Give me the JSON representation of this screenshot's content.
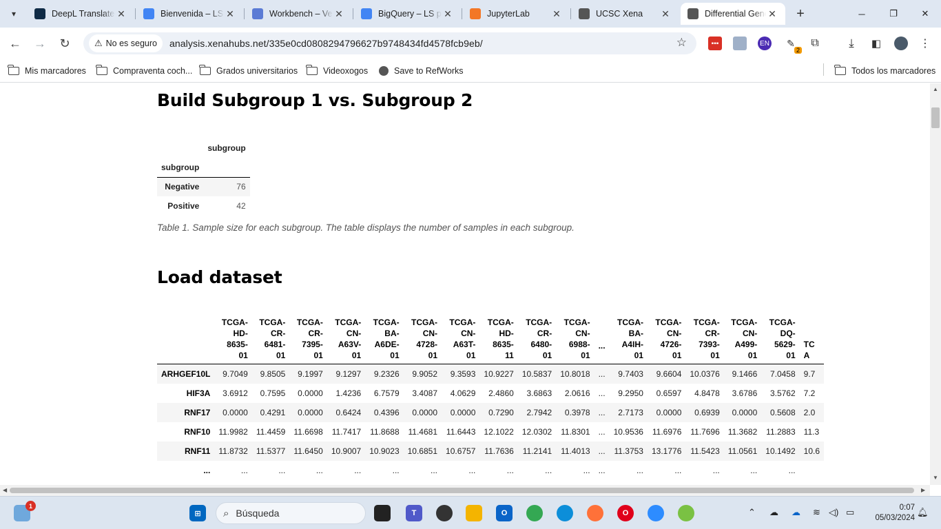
{
  "browser": {
    "tabs": [
      {
        "title": "DeepL Translate",
        "favicon": "deepl-icon",
        "color": "#0f2b46"
      },
      {
        "title": "Bienvenida – LS",
        "favicon": "google-cloud-icon",
        "color": "#4285f4"
      },
      {
        "title": "Workbench – Ve",
        "favicon": "workbench-icon",
        "color": "#5b7bd5"
      },
      {
        "title": "BigQuery – LS p",
        "favicon": "bigquery-icon",
        "color": "#4285f4"
      },
      {
        "title": "JupyterLab",
        "favicon": "jupyter-icon",
        "color": "#f37726"
      },
      {
        "title": "UCSC Xena",
        "favicon": "globe-icon",
        "color": "#555555"
      },
      {
        "title": "Differential Gene",
        "favicon": "globe-icon",
        "color": "#555555",
        "active": true
      }
    ],
    "security_label": "No es seguro",
    "url": "analysis.xenahubs.net/335e0cd0808294796627b9748434fd4578fcb9eb/",
    "extensions": {
      "translate_badge": "EN",
      "badge_count": "2"
    },
    "bookmarks": [
      {
        "label": "Mis marcadores",
        "icon": "folder-icon"
      },
      {
        "label": "Compraventa coch...",
        "icon": "folder-icon"
      },
      {
        "label": "Grados universitarios",
        "icon": "folder-icon"
      },
      {
        "label": "Videoxogos",
        "icon": "folder-icon"
      },
      {
        "label": "Save to RefWorks",
        "icon": "globe-icon"
      }
    ],
    "all_bookmarks": "Todos los marcadores"
  },
  "page": {
    "section1_title": "Build Subgroup 1 vs. Subgroup 2",
    "table1": {
      "col_header": "subgroup",
      "index_name": "subgroup",
      "rows": [
        {
          "label": "Negative",
          "value": "76"
        },
        {
          "label": "Positive",
          "value": "42"
        }
      ]
    },
    "table1_caption": "Table 1. Sample size for each subgroup. The table displays the number of samples in each subgroup.",
    "section2_title": "Load dataset",
    "table2": {
      "columns": [
        [
          "TCGA-",
          "HD-",
          "8635-",
          "01"
        ],
        [
          "TCGA-",
          "CR-",
          "6481-",
          "01"
        ],
        [
          "TCGA-",
          "CR-",
          "7395-",
          "01"
        ],
        [
          "TCGA-",
          "CN-",
          "A63V-",
          "01"
        ],
        [
          "TCGA-",
          "BA-",
          "A6DE-",
          "01"
        ],
        [
          "TCGA-",
          "CN-",
          "4728-",
          "01"
        ],
        [
          "TCGA-",
          "CN-",
          "A63T-",
          "01"
        ],
        [
          "TCGA-",
          "HD-",
          "8635-",
          "11"
        ],
        [
          "TCGA-",
          "CR-",
          "6480-",
          "01"
        ],
        [
          "TCGA-",
          "CN-",
          "6988-",
          "01"
        ],
        [
          "..."
        ],
        [
          "TCGA-",
          "BA-",
          "A4IH-",
          "01"
        ],
        [
          "TCGA-",
          "CN-",
          "4726-",
          "01"
        ],
        [
          "TCGA-",
          "CR-",
          "7393-",
          "01"
        ],
        [
          "TCGA-",
          "CN-",
          "A499-",
          "01"
        ],
        [
          "TCGA-",
          "DQ-",
          "5629-",
          "01"
        ],
        [
          "TC",
          "",
          "A",
          ""
        ]
      ],
      "rows": [
        {
          "gene": "ARHGEF10L",
          "values": [
            "9.7049",
            "9.8505",
            "9.1997",
            "9.1297",
            "9.2326",
            "9.9052",
            "9.3593",
            "10.9227",
            "10.5837",
            "10.8018",
            "...",
            "9.7403",
            "9.6604",
            "10.0376",
            "9.1466",
            "7.0458",
            "9.7"
          ]
        },
        {
          "gene": "HIF3A",
          "values": [
            "3.6912",
            "0.7595",
            "0.0000",
            "1.4236",
            "6.7579",
            "3.4087",
            "4.0629",
            "2.4860",
            "3.6863",
            "2.0616",
            "...",
            "9.2950",
            "0.6597",
            "4.8478",
            "3.6786",
            "3.5762",
            "7.2"
          ]
        },
        {
          "gene": "RNF17",
          "values": [
            "0.0000",
            "0.4291",
            "0.0000",
            "0.6424",
            "0.4396",
            "0.0000",
            "0.0000",
            "0.7290",
            "2.7942",
            "0.3978",
            "...",
            "2.7173",
            "0.0000",
            "0.6939",
            "0.0000",
            "0.5608",
            "2.0"
          ]
        },
        {
          "gene": "RNF10",
          "values": [
            "11.9982",
            "11.4459",
            "11.6698",
            "11.7417",
            "11.8688",
            "11.4681",
            "11.6443",
            "12.1022",
            "12.0302",
            "11.8301",
            "...",
            "10.9536",
            "11.6976",
            "11.7696",
            "11.3682",
            "11.2883",
            "11.3"
          ]
        },
        {
          "gene": "RNF11",
          "values": [
            "11.8732",
            "11.5377",
            "11.6450",
            "10.9007",
            "10.9023",
            "10.6851",
            "10.6757",
            "11.7636",
            "11.2141",
            "11.4013",
            "...",
            "11.3753",
            "13.1776",
            "11.5423",
            "11.0561",
            "10.1492",
            "10.6"
          ]
        },
        {
          "gene": "...",
          "values": [
            "...",
            "...",
            "...",
            "...",
            "...",
            "...",
            "...",
            "...",
            "...",
            "...",
            "...",
            "...",
            "...",
            "...",
            "...",
            "...",
            ""
          ]
        }
      ]
    }
  },
  "taskbar": {
    "search_placeholder": "Búsqueda",
    "weather_badge": "1",
    "time": "0:07",
    "date": "05/03/2024"
  }
}
